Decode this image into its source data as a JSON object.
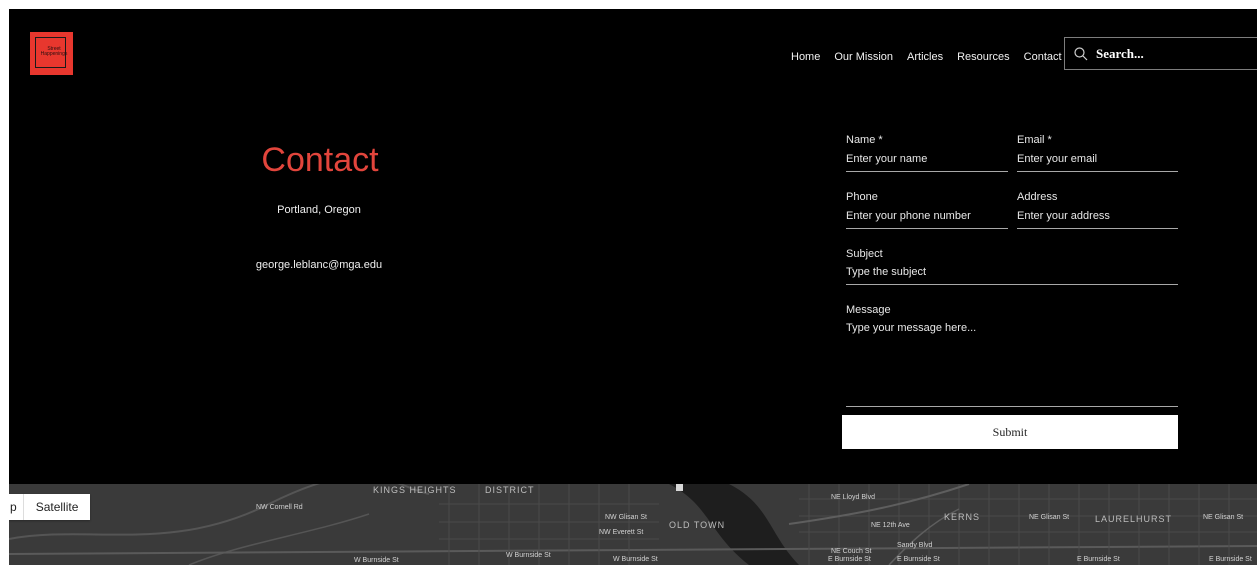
{
  "logo": {
    "text": "Street Happenings"
  },
  "nav": {
    "items": [
      "Home",
      "Our Mission",
      "Articles",
      "Resources",
      "Contact"
    ]
  },
  "search": {
    "placeholder": "Search...",
    "icon": "search-icon"
  },
  "contact": {
    "title": "Contact",
    "location": "Portland, Oregon",
    "email": "george.leblanc@mga.edu",
    "title_color": "#e2453c"
  },
  "form": {
    "name_label": "Name *",
    "name_placeholder": "Enter your name",
    "email_label": "Email *",
    "email_placeholder": "Enter your email",
    "phone_label": "Phone",
    "phone_placeholder": "Enter your phone number",
    "address_label": "Address",
    "address_placeholder": "Enter your address",
    "subject_label": "Subject",
    "subject_placeholder": "Type the subject",
    "message_label": "Message",
    "message_placeholder": "Type your message here...",
    "submit_label": "Submit"
  },
  "map": {
    "type_buttons": [
      "p",
      "Satellite"
    ],
    "labels": [
      "KINGS HEIGHTS",
      "DISTRICT",
      "NW Cornell Rd",
      "NW Glisan St",
      "NW Everett St",
      "OLD TOWN",
      "W Burnside St",
      "W Burnside St",
      "W Burnside St",
      "NE Lloyd Blvd",
      "NE 12th Ave",
      "NE Couch St",
      "E Burnside St",
      "Sandy Blvd",
      "E Burnside St",
      "KERNS",
      "NE Glisan St",
      "LAURELHURST",
      "NE Glisan St",
      "E Burnside St",
      "E Burnside St"
    ]
  }
}
